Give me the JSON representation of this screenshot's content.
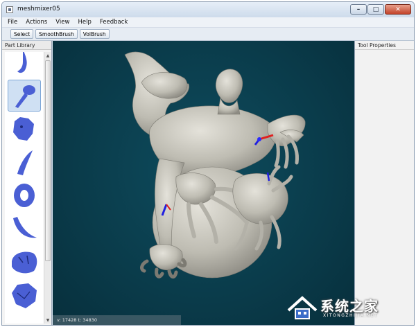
{
  "window": {
    "title": "meshmixer05"
  },
  "menu": [
    "File",
    "Actions",
    "View",
    "Help",
    "Feedback"
  ],
  "toolbar": [
    "Select",
    "SmoothBrush",
    "VolBrush"
  ],
  "left_panel": {
    "title": "Part Library"
  },
  "right_panel": {
    "title": "Tool Properties"
  },
  "status": {
    "text": "v: 17428 t: 34830"
  },
  "colors": {
    "viewport_bg": "#0a3b4a",
    "mesh": "#c8c6bd",
    "part_blue": "#4a5fd4"
  },
  "watermark": {
    "main": "系统之家",
    "sub": "XITONGZHIJIA.NET"
  }
}
